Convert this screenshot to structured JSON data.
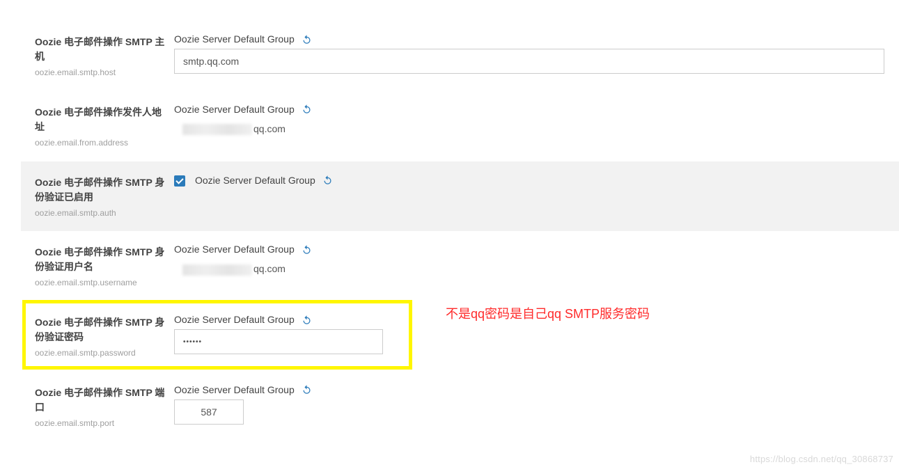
{
  "group_label": "Oozie Server Default Group",
  "rows": {
    "smtp_host": {
      "title": "Oozie 电子邮件操作 SMTP 主机",
      "key": "oozie.email.smtp.host",
      "value": "smtp.qq.com"
    },
    "from_addr": {
      "title": "Oozie 电子邮件操作发件人地址",
      "key": "oozie.email.from.address",
      "suffix": "qq.com"
    },
    "smtp_auth": {
      "title": "Oozie 电子邮件操作 SMTP 身份验证已启用",
      "key": "oozie.email.smtp.auth",
      "checked": true
    },
    "smtp_user": {
      "title": "Oozie 电子邮件操作 SMTP 身份验证用户名",
      "key": "oozie.email.smtp.username",
      "suffix": "qq.com"
    },
    "smtp_pass": {
      "title": "Oozie 电子邮件操作 SMTP 身份验证密码",
      "key": "oozie.email.smtp.password",
      "mask": "••••••"
    },
    "smtp_port": {
      "title": "Oozie 电子邮件操作 SMTP 端口",
      "key": "oozie.email.smtp.port",
      "value": "587"
    }
  },
  "annotation": "不是qq密码是自己qq SMTP服务密码",
  "watermark": "https://blog.csdn.net/qq_30868737"
}
